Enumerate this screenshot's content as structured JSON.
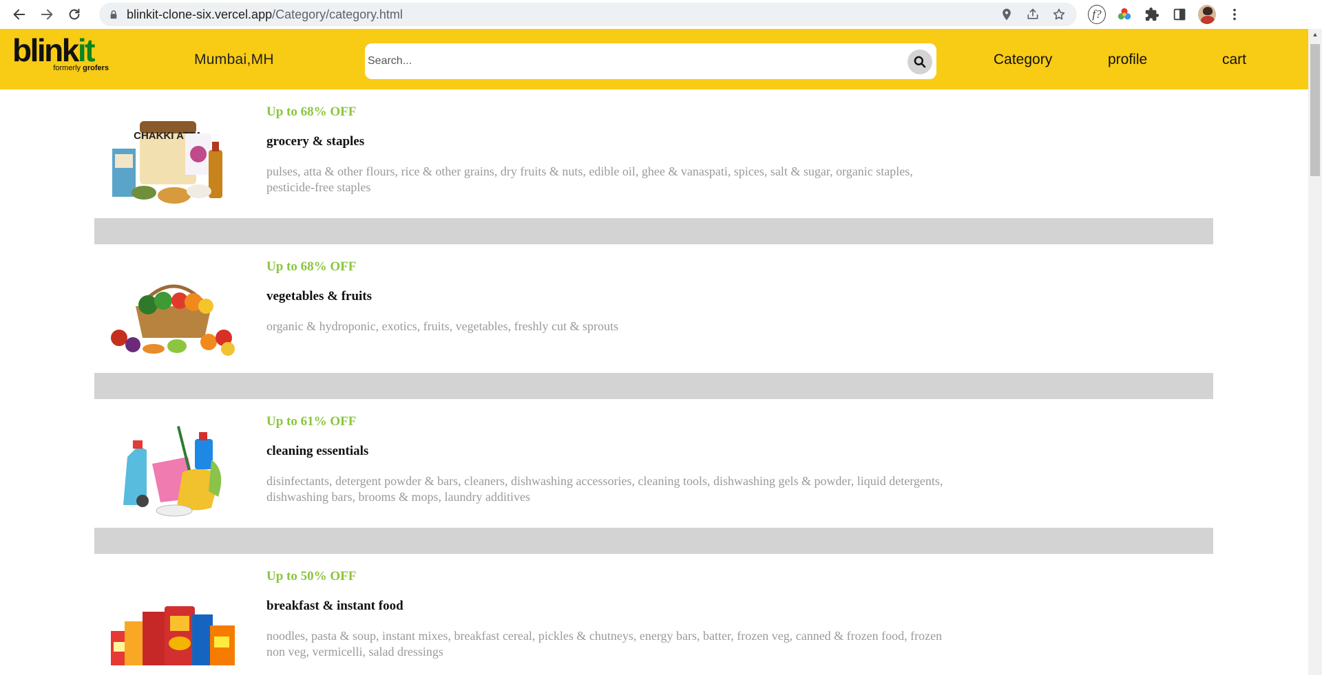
{
  "browser": {
    "url_host": "blinkit-clone-six.vercel.app",
    "url_path": "/Category/category.html"
  },
  "header": {
    "logo_main": "blink",
    "logo_accent": "it",
    "logo_sub_prefix": "formerly ",
    "logo_sub_brand": "grofers",
    "location": "Mumbai,MH",
    "search_placeholder": "Search...",
    "nav": {
      "category": "Category",
      "profile": "profile",
      "cart": "cart"
    }
  },
  "colors": {
    "header_bg": "#f8cb15",
    "offer_green": "#8ac53e",
    "separator_gray": "#d3d3d3",
    "desc_gray": "#9a9a9a"
  },
  "categories": [
    {
      "offer": "Up to 68% OFF",
      "title": "grocery & staples",
      "description": "pulses, atta & other flours, rice & other grains, dry fruits & nuts, edible oil, ghee & vanaspati, spices, salt & sugar, organic staples, pesticide-free staples",
      "image": "grocery-staples-image",
      "image_text": "CHAKKI ATTA"
    },
    {
      "offer": "Up to 68% OFF",
      "title": "vegetables & fruits",
      "description": "organic & hydroponic, exotics, fruits, vegetables, freshly cut & sprouts",
      "image": "vegetables-fruits-image"
    },
    {
      "offer": "Up to 61% OFF",
      "title": "cleaning essentials",
      "description": "disinfectants, detergent powder & bars, cleaners, dishwashing accessories, cleaning tools, dishwashing gels & powder, liquid detergents, dishwashing bars, brooms & mops, laundry additives",
      "image": "cleaning-essentials-image"
    },
    {
      "offer": "Up to 50% OFF",
      "title": "breakfast & instant food",
      "description": "noodles, pasta & soup, instant mixes, breakfast cereal, pickles & chutneys, energy bars, batter, frozen veg, canned & frozen food, frozen non veg, vermicelli, salad dressings",
      "image": "breakfast-instant-food-image"
    }
  ]
}
